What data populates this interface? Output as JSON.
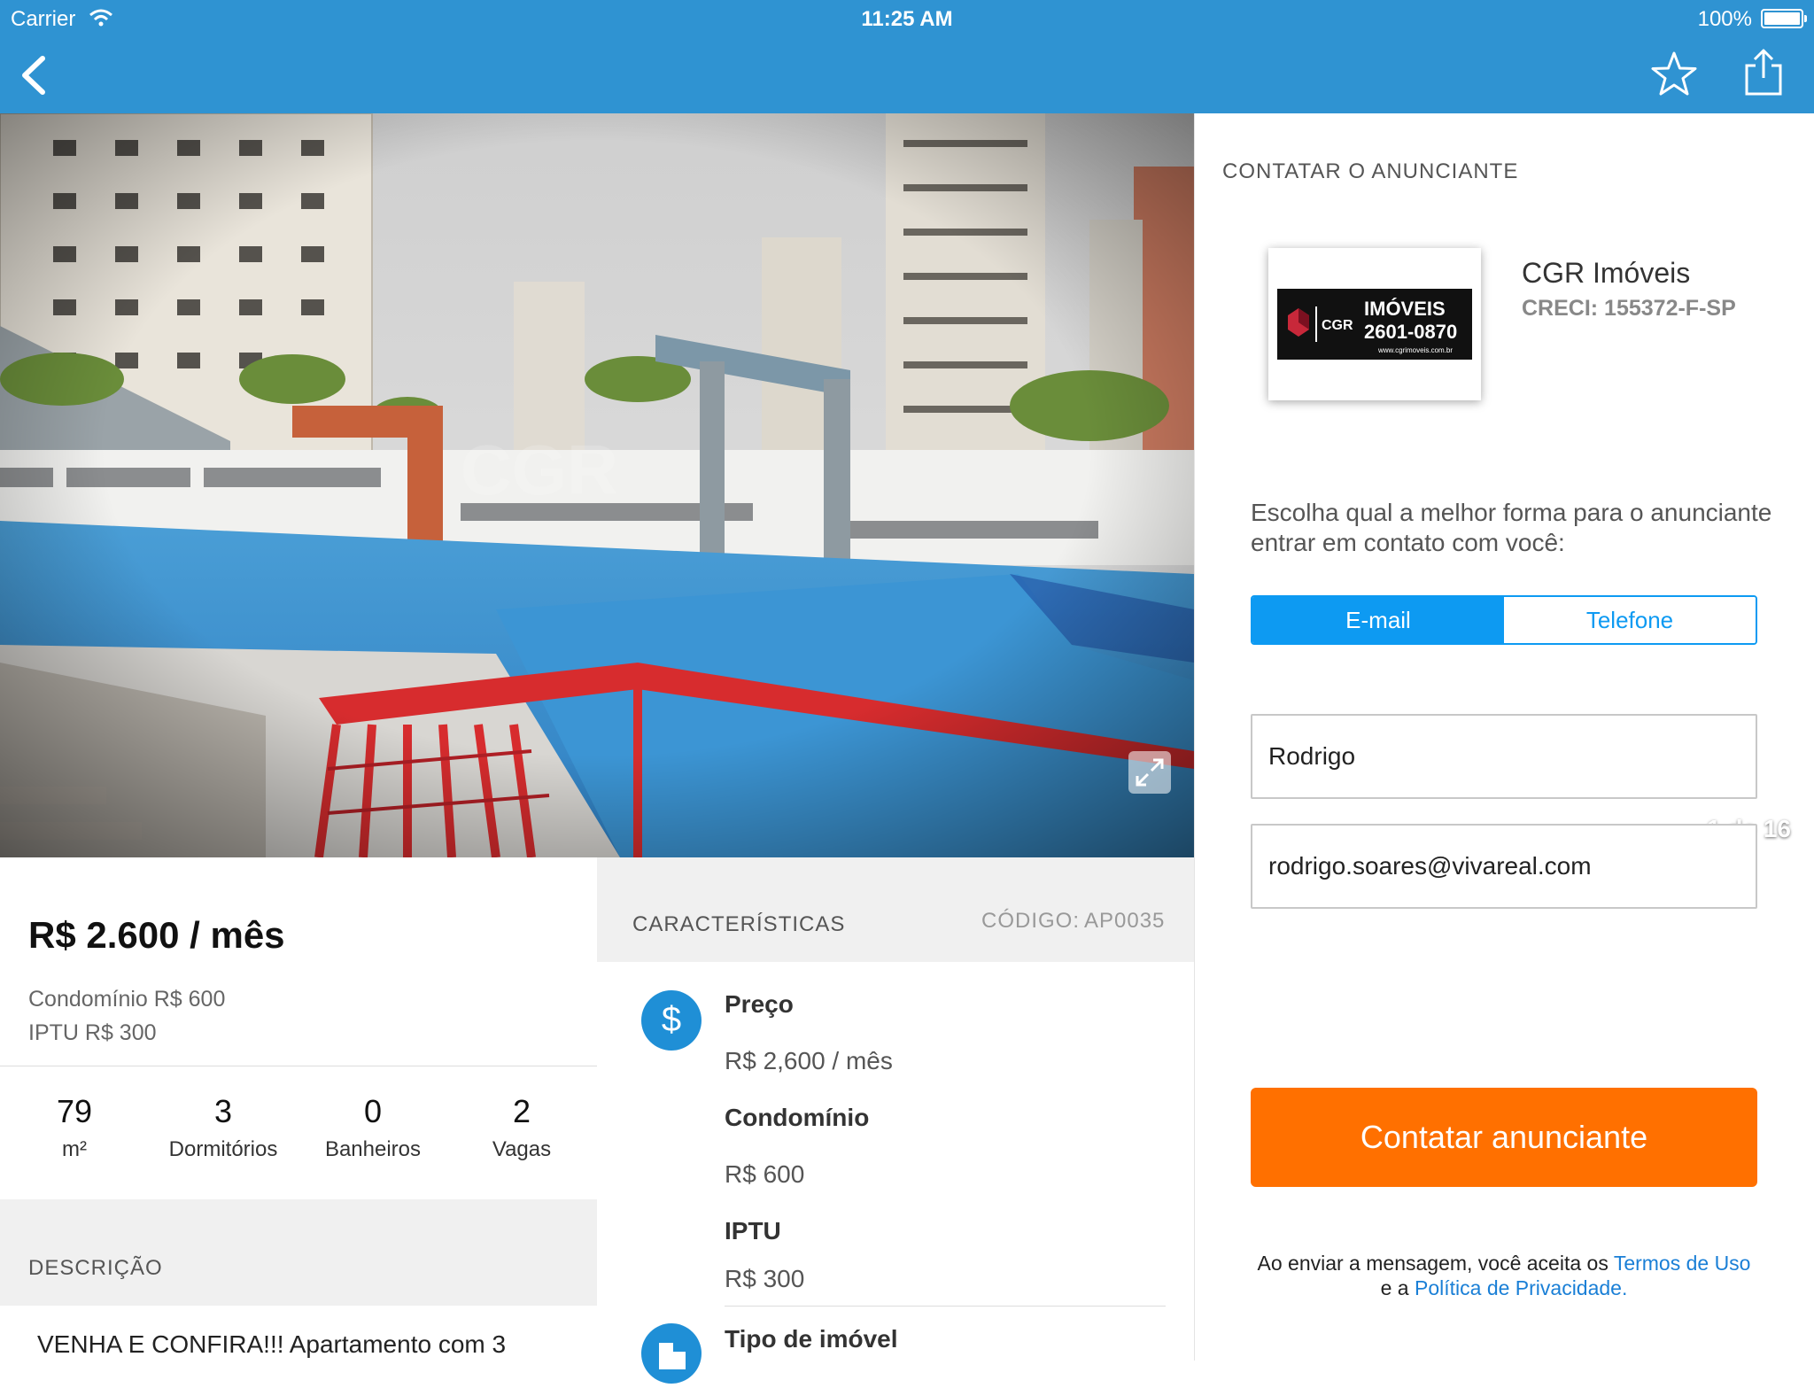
{
  "status_bar": {
    "carrier": "Carrier",
    "time": "11:25 AM",
    "battery": "100%"
  },
  "nav": {
    "back_icon": "chevron-left-icon",
    "favorite_icon": "star-outline-icon",
    "share_icon": "share-icon"
  },
  "gallery": {
    "counter": "1 de 16",
    "expand_icon": "expand-icon",
    "watermark": "CGR"
  },
  "listing": {
    "price": "R$ 2.600 / mês",
    "condominio": "Condomínio R$ 600",
    "iptu": "IPTU R$ 300",
    "stats": [
      {
        "value": "79",
        "label": "m²"
      },
      {
        "value": "3",
        "label": "Dormitórios"
      },
      {
        "value": "0",
        "label": "Banheiros"
      },
      {
        "value": "2",
        "label": "Vagas"
      }
    ],
    "description_header": "DESCRIÇÃO",
    "description_text": "VENHA E CONFIRA!!! Apartamento com 3"
  },
  "characteristics": {
    "header": "CARACTERÍSTICAS",
    "code_label": "CÓDIGO:",
    "code_value": "AP0035",
    "items": [
      {
        "icon": "dollar-icon",
        "title": "Preço",
        "value": "R$ 2,600 / mês"
      },
      {
        "title": "Condomínio",
        "value": "R$ 600"
      },
      {
        "title": "IPTU",
        "value": "R$ 300"
      },
      {
        "icon": "building-icon",
        "title": "Tipo de imóvel"
      }
    ]
  },
  "contact": {
    "header": "CONTATAR O ANUNCIANTE",
    "agency_name": "CGR Imóveis",
    "agency_creci": "CRECI: 155372-F-SP",
    "logo_brand": "CGR",
    "logo_title": "IMÓVEIS",
    "logo_phone": "2601-0870",
    "logo_url": "www.cgrimoveis.com.br",
    "choose_text": "Escolha qual a melhor forma para o anunciante entrar em contato com você:",
    "tabs": [
      "E-mail",
      "Telefone"
    ],
    "selected_tab": "E-mail",
    "name_value": "Rodrigo",
    "email_value": "rodrigo.soares@vivareal.com",
    "button_label": "Contatar anunciante",
    "terms_prefix": "Ao enviar a mensagem, você aceita os",
    "terms_link": "Termos de Uso",
    "terms_middle": "e a",
    "privacy_link": "Política de Privacidade."
  },
  "colors": {
    "nav_bar": "#2f93d2",
    "accent": "#0d9af2",
    "cta": "#ff7000",
    "icon_circle": "#1f8fd6"
  }
}
